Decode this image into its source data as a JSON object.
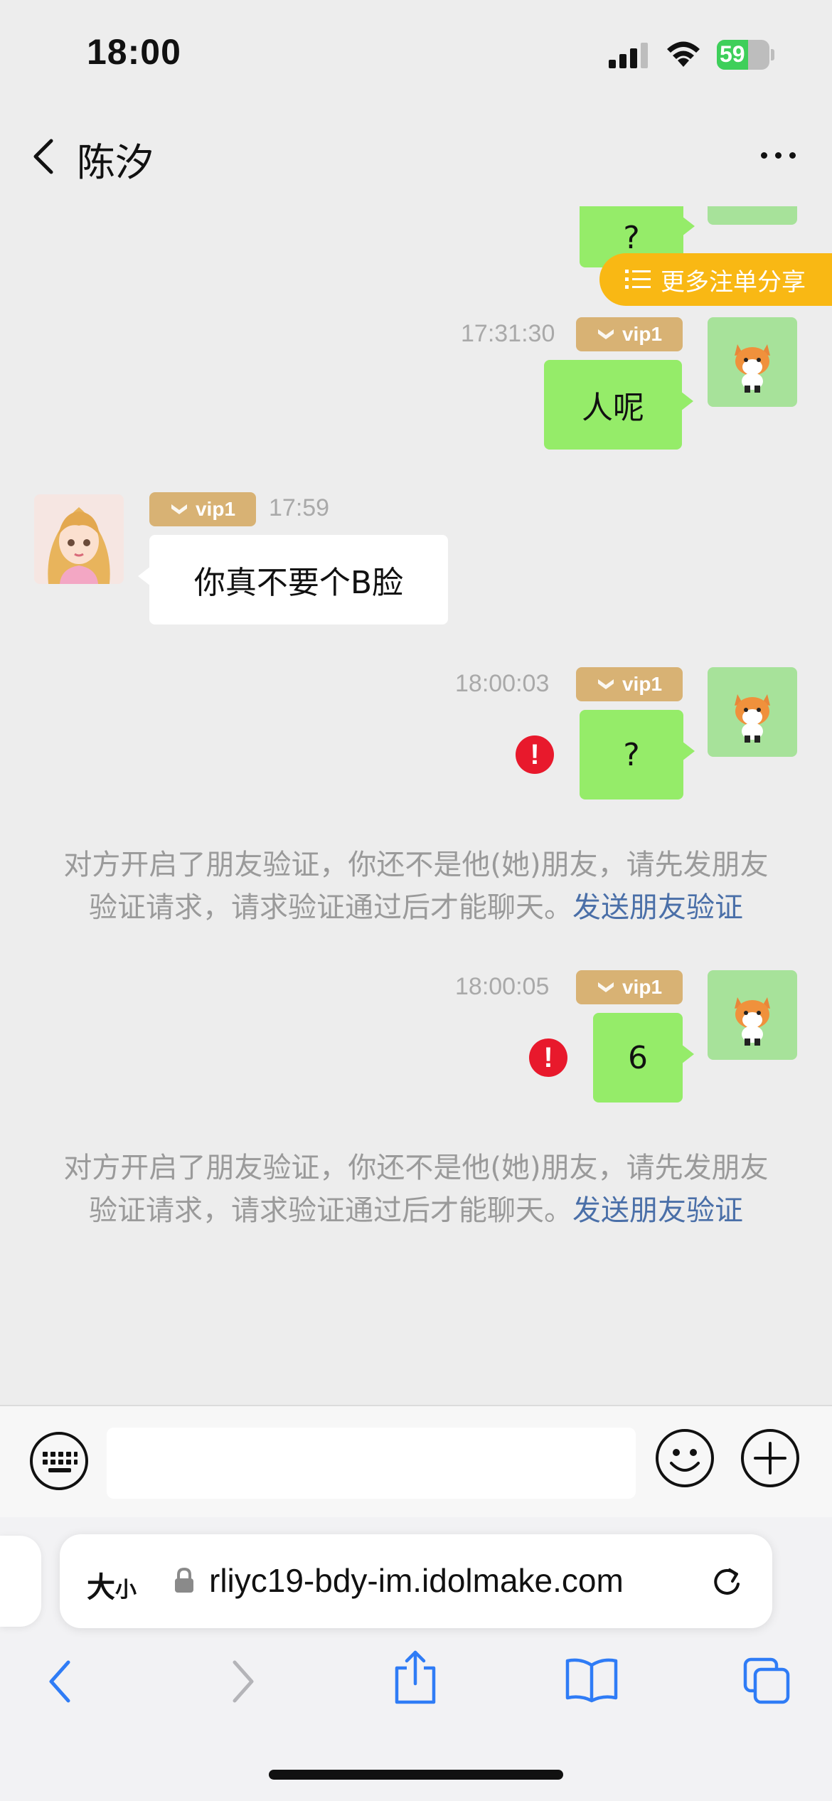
{
  "status_bar": {
    "time": "18:00",
    "battery": "59",
    "battery_level": 0.59
  },
  "header": {
    "title": "陈汐"
  },
  "share_button": {
    "label": "更多注单分享"
  },
  "messages": [
    {
      "type": "mine",
      "text": "?"
    },
    {
      "type": "mine",
      "time": "17:31:30",
      "vip": "vip1",
      "text": "人呢"
    },
    {
      "type": "theirs",
      "time": "17:59",
      "vip": "vip1",
      "text": "你真不要个B脸"
    },
    {
      "type": "mine",
      "time": "18:00:03",
      "vip": "vip1",
      "text": "?",
      "error": "!"
    },
    {
      "type": "mine",
      "time": "18:00:05",
      "vip": "vip1",
      "text": "6",
      "error": "!"
    }
  ],
  "notices": [
    {
      "line1": "对方开启了朋友验证，你还不是他(她)朋友，请先发朋友",
      "line2": "验证请求，请求验证通过后才能聊天。",
      "link": "发送朋友验证"
    },
    {
      "line1": "对方开启了朋友验证，你还不是他(她)朋友，请先发朋友",
      "line2": "验证请求，请求验证通过后才能聊天。",
      "link": "发送朋友验证"
    }
  ],
  "input": {
    "value": "",
    "placeholder": ""
  },
  "browser": {
    "aa_big": "大",
    "aa_small": "小",
    "url": "rliyc19-bdy-im.idolmake.com"
  },
  "colors": {
    "my_bubble": "#95ec69",
    "vip_badge": "#d8b274",
    "share_pill": "#f9b814",
    "error": "#e8192c",
    "link": "#4a6fa8",
    "ios_blue": "#2f7cf6"
  }
}
